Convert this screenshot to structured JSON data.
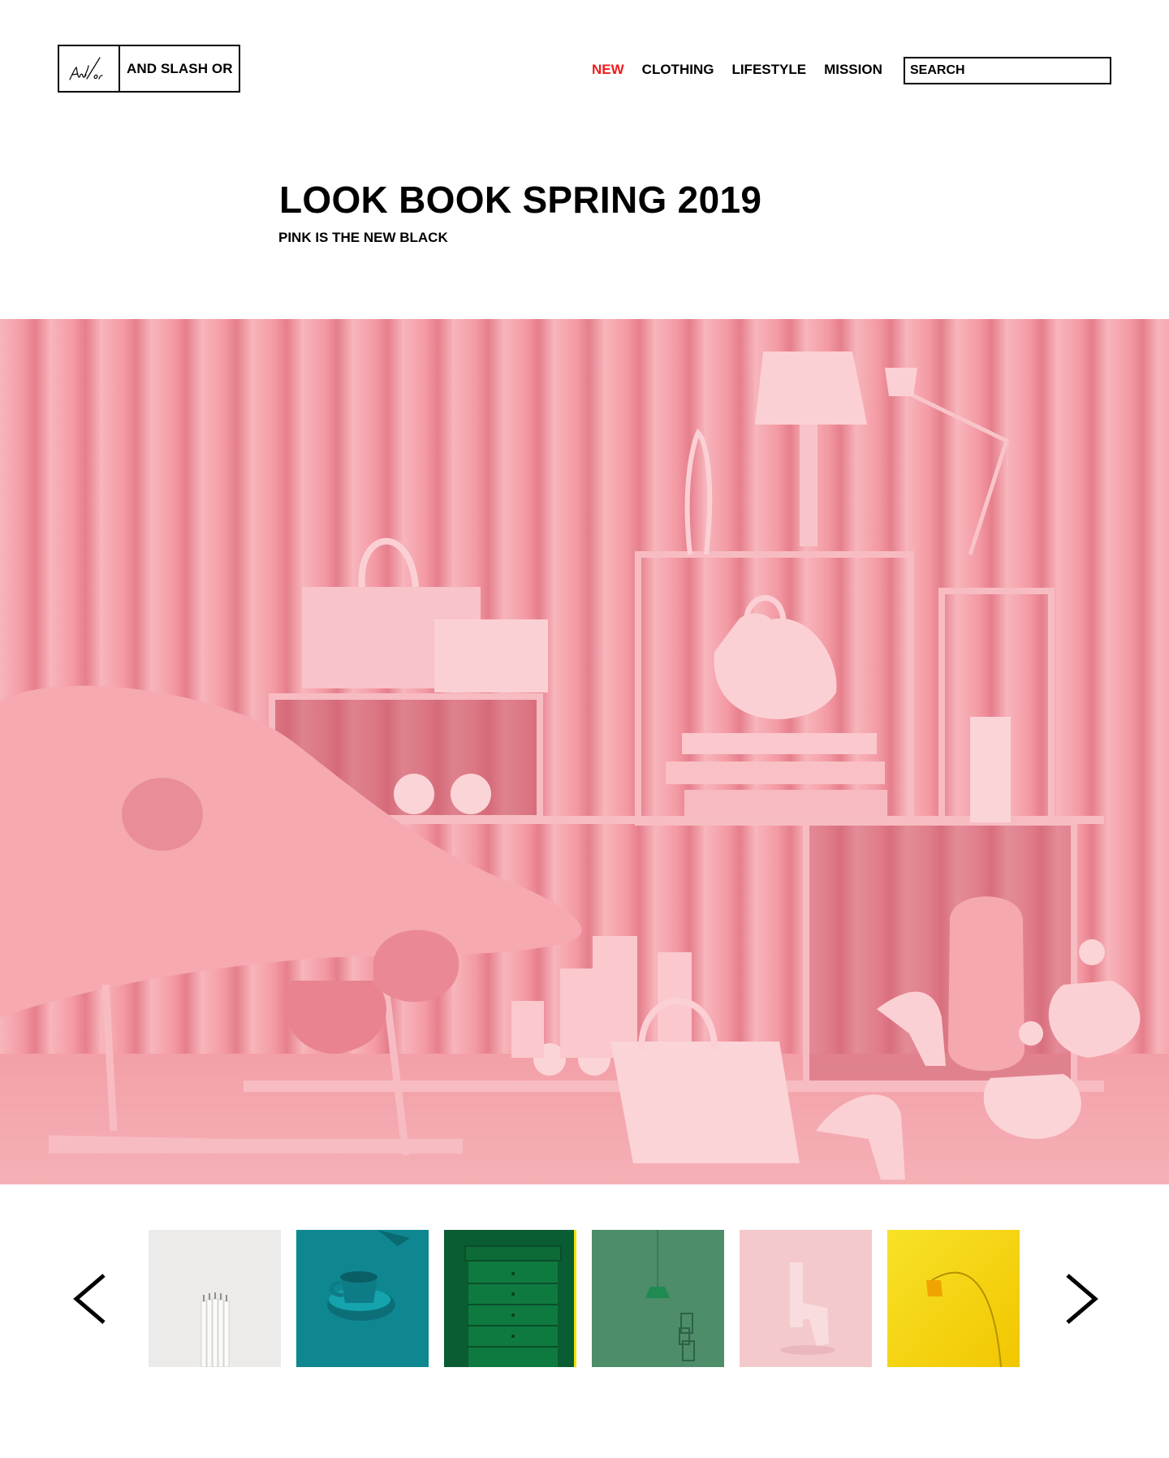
{
  "brand": {
    "name": "AND SLASH OR",
    "logo_script": "And/or"
  },
  "nav": {
    "items": [
      {
        "label": "NEW",
        "active": true
      },
      {
        "label": "CLOTHING",
        "active": false
      },
      {
        "label": "LIFESTYLE",
        "active": false
      },
      {
        "label": "MISSION",
        "active": false
      }
    ],
    "active_color": "#ee1c1c"
  },
  "search": {
    "placeholder": "SEARCH",
    "value": ""
  },
  "hero": {
    "title": "LOOK BOOK SPRING 2019",
    "subtitle": "PINK IS THE NEW BLACK",
    "image": "pink-still-life-photo"
  },
  "carousel": {
    "prev_icon": "chevron-left-icon",
    "next_icon": "chevron-right-icon",
    "thumbnails": [
      {
        "subject": "white-candles",
        "color": "#ecebe9"
      },
      {
        "subject": "teal-teacup",
        "color": "#0f8791"
      },
      {
        "subject": "green-drawer-cabinet",
        "color": "#0c6a3a"
      },
      {
        "subject": "green-pendant-lamp",
        "color": "#4d8d6a"
      },
      {
        "subject": "pink-pistol",
        "color": "#f4c9cc"
      },
      {
        "subject": "yellow-floor-lamp",
        "color": "#f5d817"
      }
    ]
  }
}
